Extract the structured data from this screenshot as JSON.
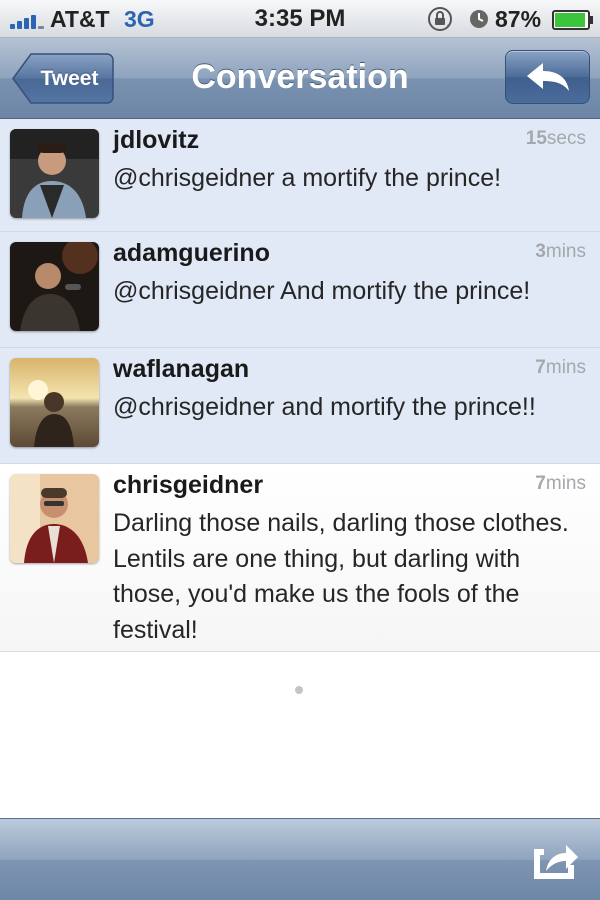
{
  "status_bar": {
    "carrier": "AT&T",
    "network": "3G",
    "time": "3:35 PM",
    "battery_percent": "87%"
  },
  "nav": {
    "back_label": "Tweet",
    "title": "Conversation",
    "reply_icon": "reply-arrow-icon"
  },
  "tweets": [
    {
      "username": "jdlovitz",
      "time_value": "15",
      "time_unit": "secs",
      "text": "@chrisgeidner a mortify the prince!"
    },
    {
      "username": "adamguerino",
      "time_value": "3",
      "time_unit": "mins",
      "text": "@chrisgeidner And mortify the prince!"
    },
    {
      "username": "waflanagan",
      "time_value": "7",
      "time_unit": "mins",
      "text": "@chrisgeidner and mortify the prince!!"
    },
    {
      "username": "chrisgeidner",
      "time_value": "7",
      "time_unit": "mins",
      "text": "Darling those nails, darling those clothes. Lentils are one thing, but darling with those, you'd make us the fools of the festival!"
    }
  ],
  "toolbar": {
    "share_icon": "share-icon"
  },
  "colors": {
    "highlight_row": "#e1e9f6",
    "accent_blue": "#2a64b3",
    "timestamp": "#a4a8ad"
  }
}
